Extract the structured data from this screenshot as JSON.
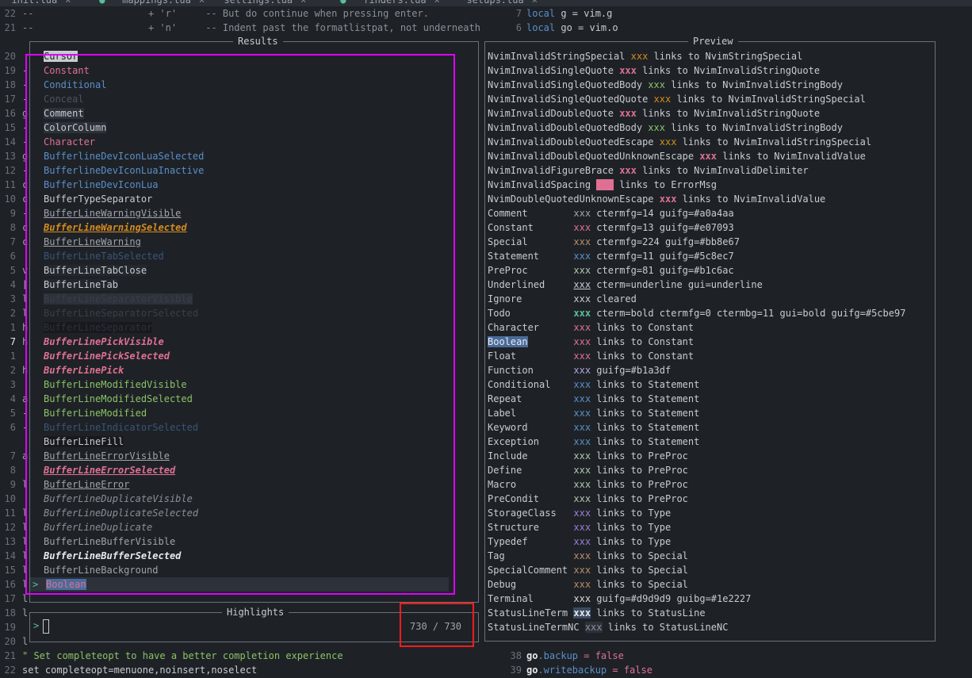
{
  "tabs": [
    {
      "label": "init.lua",
      "modified": false
    },
    {
      "label": "mappings.lua",
      "modified": true
    },
    {
      "label": "settings.lua",
      "modified": false
    },
    {
      "label": "finders.lua",
      "modified": true
    },
    {
      "label": "setups.lua",
      "modified": false
    }
  ],
  "left_editor": {
    "top_lines": [
      {
        "num": "22",
        "text": "--                    + 'r'     -- But do continue when pressing enter."
      },
      {
        "num": "21",
        "text": "--                    + 'n'     -- Indent past the formatlistpat, not underneath"
      }
    ],
    "gutter": [
      {
        "num": "20",
        "ch": ""
      },
      {
        "num": "19",
        "ch": "-"
      },
      {
        "num": "18",
        "ch": "-"
      },
      {
        "num": "17",
        "ch": "-"
      },
      {
        "num": "16",
        "ch": "g"
      },
      {
        "num": "15",
        "ch": "-"
      },
      {
        "num": "14",
        "ch": "-"
      },
      {
        "num": "13",
        "ch": "g"
      },
      {
        "num": "12",
        "ch": "-"
      },
      {
        "num": "11",
        "ch": "c"
      },
      {
        "num": "10",
        "ch": "c"
      },
      {
        "num": "9",
        "ch": "-"
      },
      {
        "num": "8",
        "ch": "c"
      },
      {
        "num": "7",
        "ch": "c"
      },
      {
        "num": "6",
        "ch": ""
      },
      {
        "num": "5",
        "ch": "v"
      },
      {
        "num": "4",
        "ch": "["
      },
      {
        "num": "3",
        "ch": "l"
      },
      {
        "num": "2",
        "ch": "l"
      },
      {
        "num": "1",
        "ch": "h"
      },
      {
        "num": "7",
        "ch": "h"
      },
      {
        "num": "1",
        "ch": ""
      },
      {
        "num": "2",
        "ch": "h"
      },
      {
        "num": "3",
        "ch": ""
      },
      {
        "num": "4",
        "ch": "a"
      },
      {
        "num": "5",
        "ch": "-"
      },
      {
        "num": "6",
        "ch": "-"
      },
      {
        "num": "",
        "ch": ""
      },
      {
        "num": "7",
        "ch": "a"
      },
      {
        "num": "8",
        "ch": ""
      },
      {
        "num": "9",
        "ch": "l"
      },
      {
        "num": "10",
        "ch": ""
      },
      {
        "num": "11",
        "ch": "l"
      },
      {
        "num": "12",
        "ch": "l"
      },
      {
        "num": "13",
        "ch": "l"
      },
      {
        "num": "14",
        "ch": "l"
      },
      {
        "num": "15",
        "ch": "l"
      },
      {
        "num": "16",
        "ch": "l"
      },
      {
        "num": "17",
        "ch": "l"
      },
      {
        "num": "18",
        "ch": "l"
      },
      {
        "num": "19",
        "ch": ""
      },
      {
        "num": "20",
        "ch": "l"
      }
    ],
    "bottom_lines": [
      {
        "num": "21",
        "text": "\" Set completeopt to have a better completion experience",
        "color": "#8cc265"
      },
      {
        "num": "22",
        "text": "set completeopt=menuone,noinsert,noselect",
        "color": "#c8cbd0"
      }
    ]
  },
  "right_editor": {
    "top_lines": [
      {
        "num": "7",
        "kw": "local",
        "rest": " g = vim.g"
      },
      {
        "num": "6",
        "kw": "local",
        "rest": " go = vim.o"
      }
    ],
    "bottom_lines": [
      {
        "num": "38",
        "obj": "go",
        "field": ".backup",
        "rest": " = false"
      },
      {
        "num": "39",
        "obj": "go",
        "field": ".writebackup",
        "rest": " = false"
      }
    ]
  },
  "results_panel": {
    "title": "Results",
    "items": [
      {
        "label": "Cursor",
        "color": "#1e2227",
        "bg": "#c8cbd0",
        "style": "normal"
      },
      {
        "label": "Constant",
        "color": "#e07093",
        "bg": "",
        "style": "normal"
      },
      {
        "label": "Conditional",
        "color": "#5c8ec7",
        "bg": "",
        "style": "normal"
      },
      {
        "label": "Conceal",
        "color": "#4f545c",
        "bg": "",
        "style": "normal"
      },
      {
        "label": "Comment",
        "color": "#c8cbd0",
        "bg": "#2c313a",
        "style": "normal"
      },
      {
        "label": "ColorColumn",
        "color": "#c8cbd0",
        "bg": "#2c313a",
        "style": "normal"
      },
      {
        "label": "Character",
        "color": "#e07093",
        "bg": "",
        "style": "normal"
      },
      {
        "label": "BufferlineDevIconLuaSelected",
        "color": "#5c8ec7",
        "bg": "",
        "style": "normal"
      },
      {
        "label": "BufferlineDevIconLuaInactive",
        "color": "#5c8ec7",
        "bg": "",
        "style": "normal"
      },
      {
        "label": "BufferlineDevIconLua",
        "color": "#5c8ec7",
        "bg": "",
        "style": "normal"
      },
      {
        "label": "BufferTypeSeparator",
        "color": "#c8cbd0",
        "bg": "",
        "style": "normal"
      },
      {
        "label": "BufferLineWarningVisible",
        "color": "#a0a4aa",
        "bg": "",
        "style": "underline"
      },
      {
        "label": "BufferLineWarningSelected",
        "color": "#d58a1e",
        "bg": "",
        "style": "bold-italic-underline"
      },
      {
        "label": "BufferLineWarning",
        "color": "#a0a4aa",
        "bg": "",
        "style": "underline"
      },
      {
        "label": "BufferLineTabSelected",
        "color": "#3a5578",
        "bg": "",
        "style": "normal"
      },
      {
        "label": "BufferLineTabClose",
        "color": "#c8cbd0",
        "bg": "#23272e",
        "style": "normal"
      },
      {
        "label": "BufferLineTab",
        "color": "#c8cbd0",
        "bg": "#23272e",
        "style": "normal"
      },
      {
        "label": "BufferLineSeparatorVisible",
        "color": "#3a3f47",
        "bg": "#2c313a",
        "style": "normal"
      },
      {
        "label": "BufferLineSeparatorSelected",
        "color": "#3a3f47",
        "bg": "",
        "style": "normal"
      },
      {
        "label": "BufferLineSeparator",
        "color": "#2c313a",
        "bg": "#17191e",
        "style": "normal"
      },
      {
        "label": "BufferLinePickVisible",
        "color": "#e07093",
        "bg": "",
        "style": "bold-italic"
      },
      {
        "label": "BufferLinePickSelected",
        "color": "#e07093",
        "bg": "",
        "style": "bold-italic"
      },
      {
        "label": "BufferLinePick",
        "color": "#e07093",
        "bg": "",
        "style": "bold-italic"
      },
      {
        "label": "BufferLineModifiedVisible",
        "color": "#8cc265",
        "bg": "",
        "style": "normal"
      },
      {
        "label": "BufferLineModifiedSelected",
        "color": "#8cc265",
        "bg": "",
        "style": "normal"
      },
      {
        "label": "BufferLineModified",
        "color": "#8cc265",
        "bg": "",
        "style": "normal"
      },
      {
        "label": "BufferLineIndicatorSelected",
        "color": "#3a5578",
        "bg": "",
        "style": "normal"
      },
      {
        "label": "BufferLineFill",
        "color": "#c8cbd0",
        "bg": "#17191e",
        "style": "normal"
      },
      {
        "label": "BufferLineErrorVisible",
        "color": "#a0a4aa",
        "bg": "",
        "style": "underline"
      },
      {
        "label": "BufferLineErrorSelected",
        "color": "#e07093",
        "bg": "",
        "style": "bold-italic-underline"
      },
      {
        "label": "BufferLineError",
        "color": "#a0a4aa",
        "bg": "",
        "style": "underline"
      },
      {
        "label": "BufferLineDuplicateVisible",
        "color": "#8a8f98",
        "bg": "",
        "style": "italic"
      },
      {
        "label": "BufferLineDuplicateSelected",
        "color": "#8a8f98",
        "bg": "",
        "style": "italic"
      },
      {
        "label": "BufferLineDuplicate",
        "color": "#8a8f98",
        "bg": "",
        "style": "italic"
      },
      {
        "label": "BufferLineBufferVisible",
        "color": "#a0a4aa",
        "bg": "",
        "style": "normal"
      },
      {
        "label": "BufferLineBufferSelected",
        "color": "#e8eaed",
        "bg": "",
        "style": "bold-italic"
      },
      {
        "label": "BufferLineBackground",
        "color": "#a0a4aa",
        "bg": "",
        "style": "normal"
      },
      {
        "label": "Boolean",
        "color": "#e07093",
        "bg": "#4a6b9a",
        "style": "normal",
        "selected": true
      }
    ],
    "selection_caret": ">"
  },
  "prompt_panel": {
    "title": "Highlights",
    "prompt": ">",
    "query": "",
    "count": "730 / 730"
  },
  "preview_panel": {
    "title": "Preview",
    "lines": [
      {
        "name": "NvimInvalidStringSpecial",
        "xxx": "xxx",
        "xc": "#d58a1e",
        "xb": "",
        "xw": "normal",
        "xu": false,
        "rest": " links to NvimStringSpecial"
      },
      {
        "name": "NvimInvalidSingleQuote",
        "xxx": "xxx",
        "xc": "#e07093",
        "xb": "",
        "xw": "bold",
        "xu": false,
        "rest": " links to NvimInvalidStringQuote"
      },
      {
        "name": "NvimInvalidSingleQuotedBody",
        "xxx": "xxx",
        "xc": "#8cc265",
        "xb": "",
        "xw": "normal",
        "xu": false,
        "rest": " links to NvimInvalidStringBody"
      },
      {
        "name": "NvimInvalidSingleQuotedQuote",
        "xxx": "xxx",
        "xc": "#d58a1e",
        "xb": "",
        "xw": "normal",
        "xu": false,
        "rest": " links to NvimInvalidStringSpecial"
      },
      {
        "name": "NvimInvalidDoubleQuote",
        "xxx": "xxx",
        "xc": "#e07093",
        "xb": "",
        "xw": "bold",
        "xu": false,
        "rest": " links to NvimInvalidStringQuote"
      },
      {
        "name": "NvimInvalidDoubleQuotedBody",
        "xxx": "xxx",
        "xc": "#8cc265",
        "xb": "",
        "xw": "normal",
        "xu": false,
        "rest": " links to NvimInvalidStringBody"
      },
      {
        "name": "NvimInvalidDoubleQuotedEscape",
        "xxx": "xxx",
        "xc": "#d58a1e",
        "xb": "",
        "xw": "normal",
        "xu": false,
        "rest": " links to NvimInvalidStringSpecial"
      },
      {
        "name": "NvimInvalidDoubleQuotedUnknownEscape",
        "xxx": "xxx",
        "xc": "#e07093",
        "xb": "",
        "xw": "bold",
        "xu": false,
        "rest": " links to NvimInvalidValue"
      },
      {
        "name": "NvimInvalidFigureBrace",
        "xxx": "xxx",
        "xc": "#e07093",
        "xb": "",
        "xw": "bold",
        "xu": false,
        "rest": " links to NvimInvalidDelimiter"
      },
      {
        "name": "NvimInvalidSpacing",
        "xxx": "xxx",
        "xc": "#e07093",
        "xb": "#e07093",
        "xw": "normal",
        "xu": false,
        "rest": " links to ErrorMsg"
      },
      {
        "name": "NvimDoubleQuotedUnknownEscape",
        "xxx": "xxx",
        "xc": "#e07093",
        "xb": "",
        "xw": "bold",
        "xu": false,
        "rest": " links to NvimInvalidValue"
      },
      {
        "name": "Comment       ",
        "xxx": "xxx",
        "xc": "#a0a4aa",
        "xb": "",
        "xw": "normal",
        "xu": false,
        "rest": " ctermfg=14 guifg=#a0a4aa"
      },
      {
        "name": "Constant      ",
        "xxx": "xxx",
        "xc": "#e07093",
        "xb": "",
        "xw": "normal",
        "xu": false,
        "rest": " ctermfg=13 guifg=#e07093"
      },
      {
        "name": "Special       ",
        "xxx": "xxx",
        "xc": "#bb8e67",
        "xb": "",
        "xw": "normal",
        "xu": false,
        "rest": " ctermfg=224 guifg=#bb8e67"
      },
      {
        "name": "Statement     ",
        "xxx": "xxx",
        "xc": "#5c8ec7",
        "xb": "",
        "xw": "normal",
        "xu": false,
        "rest": " ctermfg=11 guifg=#5c8ec7"
      },
      {
        "name": "PreProc       ",
        "xxx": "xxx",
        "xc": "#b1c6ac",
        "xb": "",
        "xw": "normal",
        "xu": false,
        "rest": " ctermfg=81 guifg=#b1c6ac"
      },
      {
        "name": "Underlined    ",
        "xxx": "xxx",
        "xc": "#c8cbd0",
        "xb": "",
        "xw": "normal",
        "xu": true,
        "rest": " cterm=underline gui=underline"
      },
      {
        "name": "Ignore        ",
        "xxx": "xxx",
        "xc": "#c8cbd0",
        "xb": "",
        "xw": "normal",
        "xu": false,
        "rest": " cleared"
      },
      {
        "name": "Todo          ",
        "xxx": "xxx",
        "xc": "#5cbe97",
        "xb": "",
        "xw": "bold",
        "xu": false,
        "rest": " cterm=bold ctermfg=0 ctermbg=11 gui=bold guifg=#5cbe97"
      },
      {
        "name": "Character     ",
        "xxx": "xxx",
        "xc": "#e07093",
        "xb": "",
        "xw": "normal",
        "xu": false,
        "rest": " links to Constant"
      },
      {
        "name": "Boolean",
        "xxx": "xxx",
        "xc": "#e07093",
        "xb": "",
        "xw": "normal",
        "xu": false,
        "rest": " links to Constant",
        "name_highlight": true
      },
      {
        "name": "Float         ",
        "xxx": "xxx",
        "xc": "#e07093",
        "xb": "",
        "xw": "normal",
        "xu": false,
        "rest": " links to Constant"
      },
      {
        "name": "Function      ",
        "xxx": "xxx",
        "xc": "#b1a3df",
        "xb": "",
        "xw": "normal",
        "xu": false,
        "rest": " guifg=#b1a3df"
      },
      {
        "name": "Conditional   ",
        "xxx": "xxx",
        "xc": "#5c8ec7",
        "xb": "",
        "xw": "normal",
        "xu": false,
        "rest": " links to Statement"
      },
      {
        "name": "Repeat        ",
        "xxx": "xxx",
        "xc": "#5c8ec7",
        "xb": "",
        "xw": "normal",
        "xu": false,
        "rest": " links to Statement"
      },
      {
        "name": "Label         ",
        "xxx": "xxx",
        "xc": "#5c8ec7",
        "xb": "",
        "xw": "normal",
        "xu": false,
        "rest": " links to Statement"
      },
      {
        "name": "Keyword       ",
        "xxx": "xxx",
        "xc": "#5c8ec7",
        "xb": "",
        "xw": "normal",
        "xu": false,
        "rest": " links to Statement"
      },
      {
        "name": "Exception     ",
        "xxx": "xxx",
        "xc": "#5c8ec7",
        "xb": "",
        "xw": "normal",
        "xu": false,
        "rest": " links to Statement"
      },
      {
        "name": "Include       ",
        "xxx": "xxx",
        "xc": "#b1c6ac",
        "xb": "",
        "xw": "normal",
        "xu": false,
        "rest": " links to PreProc"
      },
      {
        "name": "Define        ",
        "xxx": "xxx",
        "xc": "#b1c6ac",
        "xb": "",
        "xw": "normal",
        "xu": false,
        "rest": " links to PreProc"
      },
      {
        "name": "Macro         ",
        "xxx": "xxx",
        "xc": "#b1c6ac",
        "xb": "",
        "xw": "normal",
        "xu": false,
        "rest": " links to PreProc"
      },
      {
        "name": "PreCondit     ",
        "xxx": "xxx",
        "xc": "#b1c6ac",
        "xb": "",
        "xw": "normal",
        "xu": false,
        "rest": " links to PreProc"
      },
      {
        "name": "StorageClass  ",
        "xxx": "xxx",
        "xc": "#9b7fd4",
        "xb": "",
        "xw": "normal",
        "xu": false,
        "rest": " links to Type"
      },
      {
        "name": "Structure     ",
        "xxx": "xxx",
        "xc": "#9b7fd4",
        "xb": "",
        "xw": "normal",
        "xu": false,
        "rest": " links to Type"
      },
      {
        "name": "Typedef       ",
        "xxx": "xxx",
        "xc": "#9b7fd4",
        "xb": "",
        "xw": "normal",
        "xu": false,
        "rest": " links to Type"
      },
      {
        "name": "Tag           ",
        "xxx": "xxx",
        "xc": "#bb8e67",
        "xb": "",
        "xw": "normal",
        "xu": false,
        "rest": " links to Special"
      },
      {
        "name": "SpecialComment",
        "xxx": "xxx",
        "xc": "#bb8e67",
        "xb": "",
        "xw": "normal",
        "xu": false,
        "rest": " links to Special"
      },
      {
        "name": "Debug         ",
        "xxx": "xxx",
        "xc": "#bb8e67",
        "xb": "",
        "xw": "normal",
        "xu": false,
        "rest": " links to Special"
      },
      {
        "name": "Terminal      ",
        "xxx": "xxx",
        "xc": "#d9d9d9",
        "xb": "",
        "xw": "normal",
        "xu": false,
        "rest": " guifg=#d9d9d9 guibg=#1e2227"
      },
      {
        "name": "StatusLineTerm",
        "xxx": "xxx",
        "xc": "#e8eaed",
        "xb": "#3a4a60",
        "xw": "bold",
        "xu": false,
        "rest": " links to StatusLine"
      },
      {
        "name": "StatusLineTermNC",
        "xxx": "xxx",
        "xc": "#8a8f98",
        "xb": "#2c313a",
        "xw": "normal",
        "xu": false,
        "rest": " links to StatusLineNC"
      }
    ]
  },
  "colors": {
    "background": "#1e2227",
    "border": "#6b7079",
    "annotation_magenta": "#e100ff",
    "annotation_red": "#ff1b1b",
    "selection_bg": "#4a6b9a",
    "green": "#8cc265",
    "pink": "#e07093",
    "blue": "#5c8ec7"
  }
}
